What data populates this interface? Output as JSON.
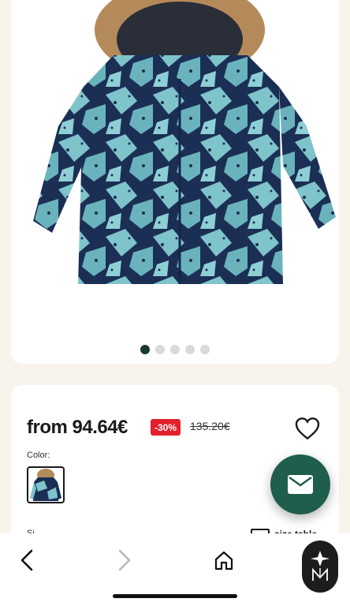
{
  "product": {
    "price": "from 94.64€",
    "discount_badge": "-30%",
    "original_price": "135.20€",
    "color_label": "Color:",
    "size_label": "Si",
    "size_table_label": "size table"
  },
  "gallery": {
    "image_count": 5,
    "active_index": 0
  },
  "icons": {
    "favorite": "heart-outline-icon",
    "contact": "mail-icon",
    "back": "chevron-left-icon",
    "forward": "chevron-right-icon",
    "home": "home-icon",
    "brand": "brand-logo-icon"
  },
  "colors": {
    "background": "#f8f4ec",
    "discount": "#e4202e",
    "fab": "#1f5d4c",
    "active_dot": "#193a2c",
    "jacket_navy": "#1b2f55",
    "jacket_teal": "#7fc3cb"
  }
}
